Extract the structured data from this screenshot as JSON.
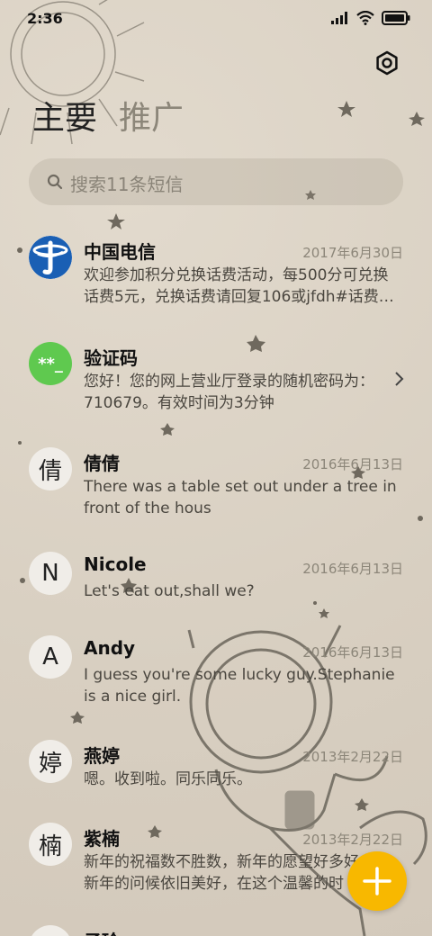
{
  "status": {
    "time": "2:36"
  },
  "tabs": [
    {
      "label": "主要",
      "active": true
    },
    {
      "label": "推广",
      "active": false
    }
  ],
  "search": {
    "placeholder": "搜索11条短信"
  },
  "messages": [
    {
      "sender": "中国电信",
      "date": "2017年6月30日",
      "preview": "欢迎参加积分兑换话费活动，每500分可兑换话费5元，兑换话费请回复106或jfdh#话费…",
      "avatar": "telecom-logo"
    },
    {
      "sender": "验证码",
      "date": "",
      "preview": "您好！您的网上营业厅登录的随机密码为：710679。有效时间为3分钟",
      "avatar": "**_"
    },
    {
      "sender": "倩倩",
      "date": "2016年6月13日",
      "preview": "There was a table set out under a tree in front of the hous",
      "avatar": "倩"
    },
    {
      "sender": "Nicole",
      "date": "2016年6月13日",
      "preview": "Let's eat out,shall we?",
      "avatar": "N"
    },
    {
      "sender": "Andy",
      "date": "2016年6月13日",
      "preview": "I guess you're some lucky guy.Stephanie is a nice girl.",
      "avatar": "A"
    },
    {
      "sender": "燕婷",
      "date": "2013年2月22日",
      "preview": "嗯。收到啦。同乐同乐。",
      "avatar": "婷"
    },
    {
      "sender": "紫楠",
      "date": "2013年2月22日",
      "preview": "新年的祝福数不胜数，新年的愿望好多好多，新年的问候依旧美好，在这个温馨的时",
      "avatar": "楠"
    },
    {
      "sender": "子玲",
      "date": "",
      "preview": "",
      "avatar": ""
    }
  ],
  "colors": {
    "accent": "#f8b800",
    "background": "#dcd3c6",
    "verify_avatar": "#5fc94f",
    "telecom_blue": "#1a5fb4"
  }
}
